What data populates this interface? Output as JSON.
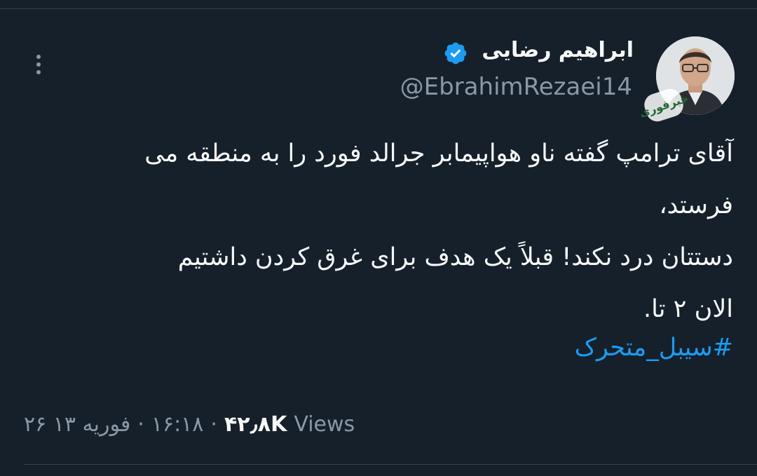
{
  "author": {
    "display_name": "ابراهیم رضایی",
    "handle": "@EbrahimRezaei14",
    "avatar_badge_text": "خبرفوری"
  },
  "tweet": {
    "lines": [
      "آقای ترامپ گفته ناو هواپیمابر جرالد فورد را به منطقه می",
      "فرستد،",
      "دستتان درد نکند! قبلاً یک هدف برای غرق کردن داشتیم",
      "الان ۲ تا."
    ],
    "hashtag": "#سیبل_متحرک"
  },
  "meta": {
    "date": "۲۶ فوریه ۱۳",
    "separator": "·",
    "time": "۱۶:۱۸",
    "views_count": "۴۲٫۸K",
    "views_label": "Views"
  },
  "colors": {
    "background": "#15202b",
    "text_primary": "#f7f9f9",
    "text_secondary": "#8b98a5",
    "accent": "#1d9bf0",
    "divider": "#38444d"
  },
  "icons": {
    "more": "more-vertical-icon",
    "verified": "verified-badge-icon"
  }
}
